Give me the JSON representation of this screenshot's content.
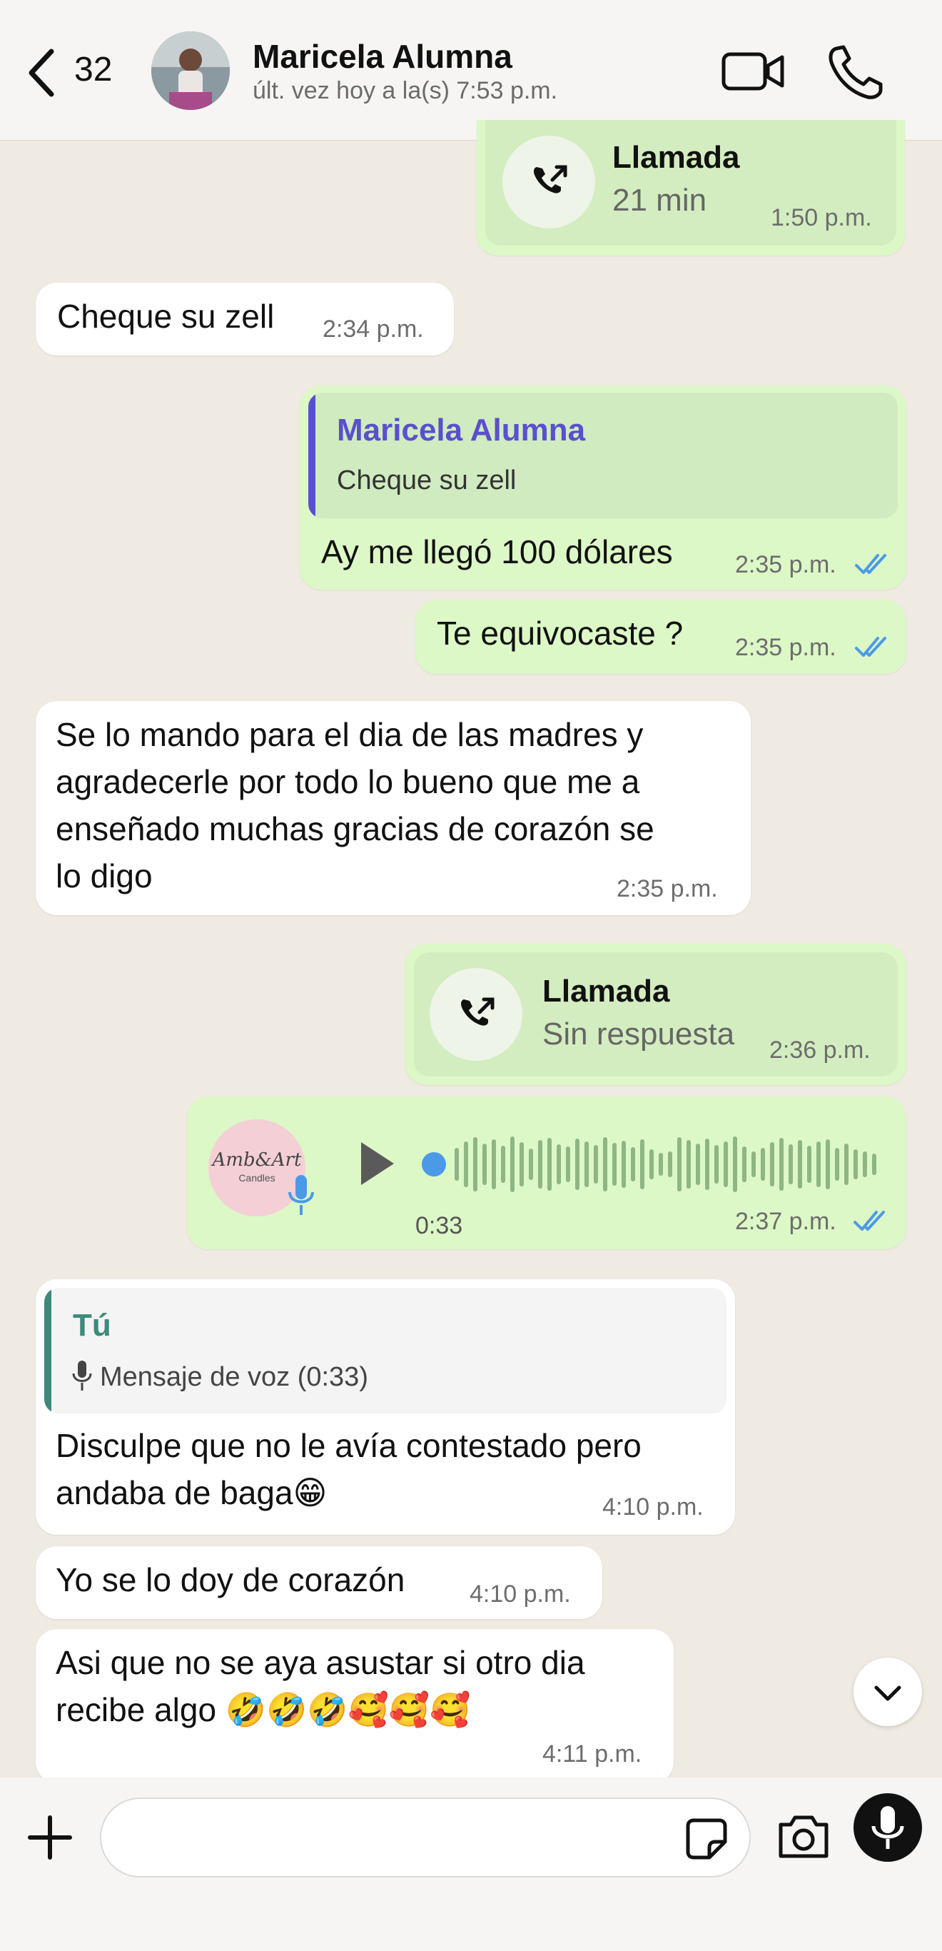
{
  "header": {
    "back_count": "32",
    "contact_name": "Maricela Alumna",
    "last_seen": "últ. vez hoy a la(s) 7:53 p.m."
  },
  "messages": [
    {
      "type": "call",
      "direction": "out",
      "title": "Llamada",
      "subtitle": "21 min",
      "time": "1:50 p.m."
    },
    {
      "type": "text",
      "direction": "in",
      "text": "Cheque su zell",
      "time": "2:34 p.m."
    },
    {
      "type": "reply",
      "direction": "out",
      "quote_author": "Maricela Alumna",
      "quote_text": "Cheque su zell",
      "text": "Ay me llegó 100 dólares",
      "time": "2:35 p.m.",
      "status": "read"
    },
    {
      "type": "text",
      "direction": "out",
      "text": "Te equivocaste ?",
      "time": "2:35 p.m.",
      "status": "read"
    },
    {
      "type": "text",
      "direction": "in",
      "lines": [
        "Se lo mando para el dia de las madres y",
        "agradecerle por todo lo bueno que me a",
        "enseñado muchas gracias de corazón se",
        "lo digo"
      ],
      "time": "2:35 p.m."
    },
    {
      "type": "call",
      "direction": "out",
      "title": "Llamada",
      "subtitle": "Sin respuesta",
      "time": "2:36 p.m."
    },
    {
      "type": "voice",
      "direction": "out",
      "avatar_text": "Amb&Art",
      "avatar_sub": "Candles",
      "duration": "0:33",
      "time": "2:37 p.m.",
      "status": "read"
    },
    {
      "type": "reply",
      "direction": "in",
      "quote_author": "Tú",
      "quote_text": "Mensaje de voz (0:33)",
      "lines": [
        "Disculpe que no le avía contestado pero",
        "andaba de baga😁"
      ],
      "time": "4:10 p.m."
    },
    {
      "type": "text",
      "direction": "in",
      "text": "Yo se lo doy de corazón",
      "time": "4:10 p.m."
    },
    {
      "type": "text",
      "direction": "in",
      "lines": [
        "Asi que no se  aya asustar si otro dia",
        "recibe algo 🤣🤣🤣🥰🥰🥰"
      ],
      "time": "4:11 p.m."
    }
  ],
  "colors": {
    "accent_purple": "#5a4fcf",
    "accent_teal": "#3d8a7b",
    "tick_blue": "#4a9ae8",
    "out_bubble": "#dcf8c6"
  },
  "icons": [
    "chevron-left-icon",
    "video-icon",
    "phone-icon",
    "outgoing-call-icon",
    "play-icon",
    "mic-icon",
    "plus-icon",
    "sticker-icon",
    "camera-icon",
    "chevron-down-icon"
  ]
}
